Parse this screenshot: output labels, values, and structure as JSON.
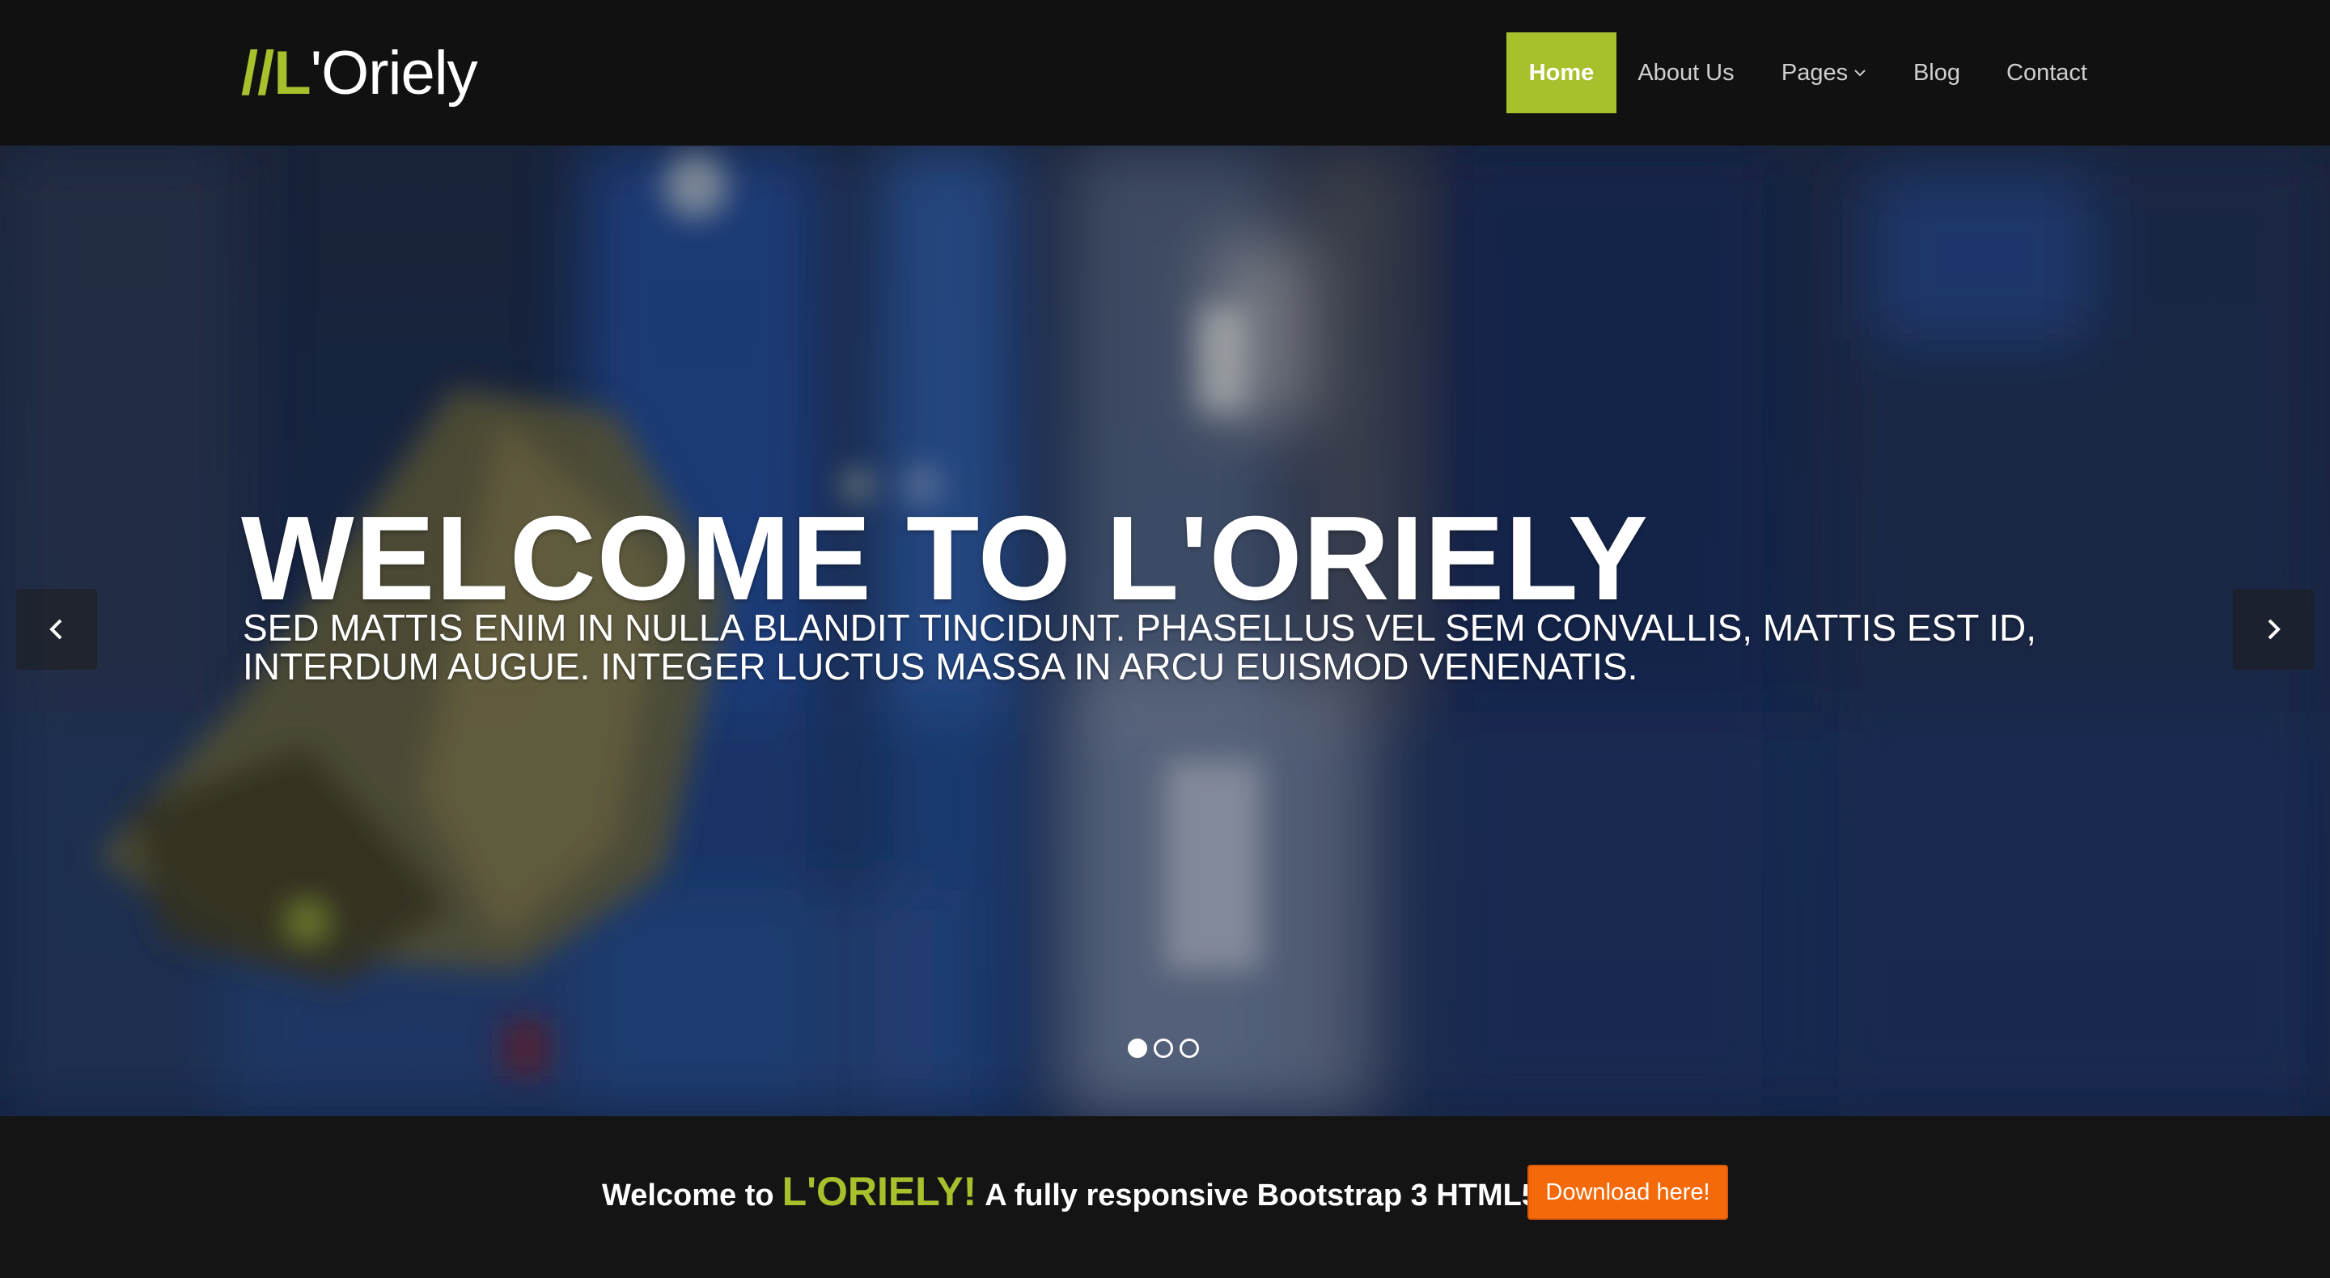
{
  "brand": {
    "prefix": "//L",
    "rest": "'Oriely",
    "accent_color": "#a7c12d"
  },
  "nav": {
    "items": [
      {
        "label": "Home",
        "active": true
      },
      {
        "label": "About Us"
      },
      {
        "label": "Pages",
        "has_dropdown": true,
        "icon": "chevron-down-icon"
      },
      {
        "label": "Blog"
      },
      {
        "label": "Contact"
      }
    ]
  },
  "hero": {
    "title": "WELCOME TO L'ORIELY",
    "subtitle": "SED MATTIS ENIM IN NULLA BLANDIT TINCIDUNT. PHASELLUS VEL SEM CONVALLIS, MATTIS EST ID, INTERDUM AUGUE. INTEGER LUCTUS MASSA IN ARCU EUISMOD VENENATIS.",
    "prev_icon": "chevron-left-icon",
    "next_icon": "chevron-right-icon",
    "slides_count": 3,
    "active_slide": 1
  },
  "promo": {
    "lead": "Welcome to",
    "brand": "L'ORIELY!",
    "tail": "A fully responsive Bootstrap 3 HTML5!",
    "button_label": "Download here!",
    "button_color": "#f46a0a"
  }
}
